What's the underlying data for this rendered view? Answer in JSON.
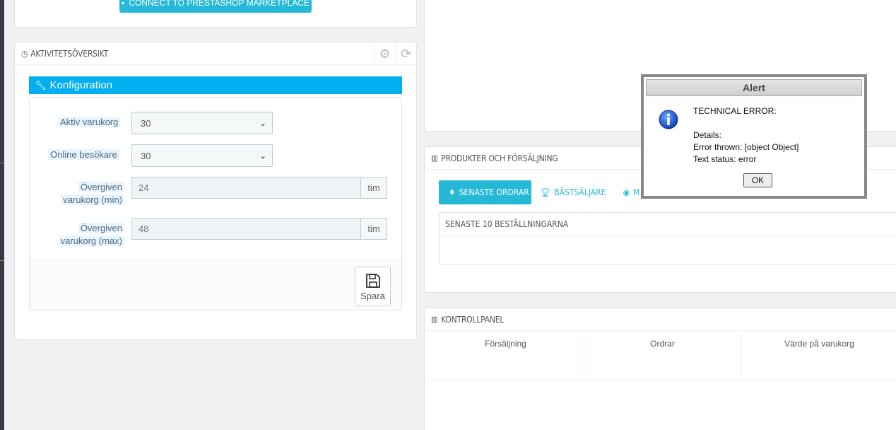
{
  "connect": {
    "button_label": "CONNECT TO PRESTASHOP MARKETPLACE"
  },
  "activity": {
    "title": "AKTIVITETSÖVERSIKT",
    "config_title": "Konfiguration",
    "fields": {
      "active_cart_label": "Aktiv varukorg",
      "active_cart_value": "30",
      "online_visitors_label": "Online besökare",
      "online_visitors_value": "30",
      "abandoned_min_label_1": "Övergiven",
      "abandoned_min_label_2": "varukorg (min)",
      "abandoned_min_value": "24",
      "abandoned_min_unit": "tim",
      "abandoned_max_label_1": "Övergiven",
      "abandoned_max_label_2": "varukorg (max)",
      "abandoned_max_value": "48",
      "abandoned_max_unit": "tim"
    },
    "save_label": "Spara"
  },
  "products": {
    "title": "PRODUKTER OCH FÖRSÄLJNING",
    "tabs": [
      {
        "label": "SENASTE ORDRAR"
      },
      {
        "label": "BÄSTSÄLJARE"
      },
      {
        "label": "M"
      }
    ],
    "latest_title": "SENASTE 10 BESTÄLLNINGARNA"
  },
  "dashboard": {
    "title": "KONTROLLPANEL",
    "kpis": [
      "Försäljning",
      "Ordrar",
      "Värde på varukorg"
    ]
  },
  "alert": {
    "title": "Alert",
    "message": "TECHNICAL ERROR:\n\nDetails:\nError thrown: [object Object]\nText status: error",
    "ok_label": "OK"
  },
  "colors": {
    "accent": "#25b9d7",
    "config_bar": "#00aff0"
  }
}
